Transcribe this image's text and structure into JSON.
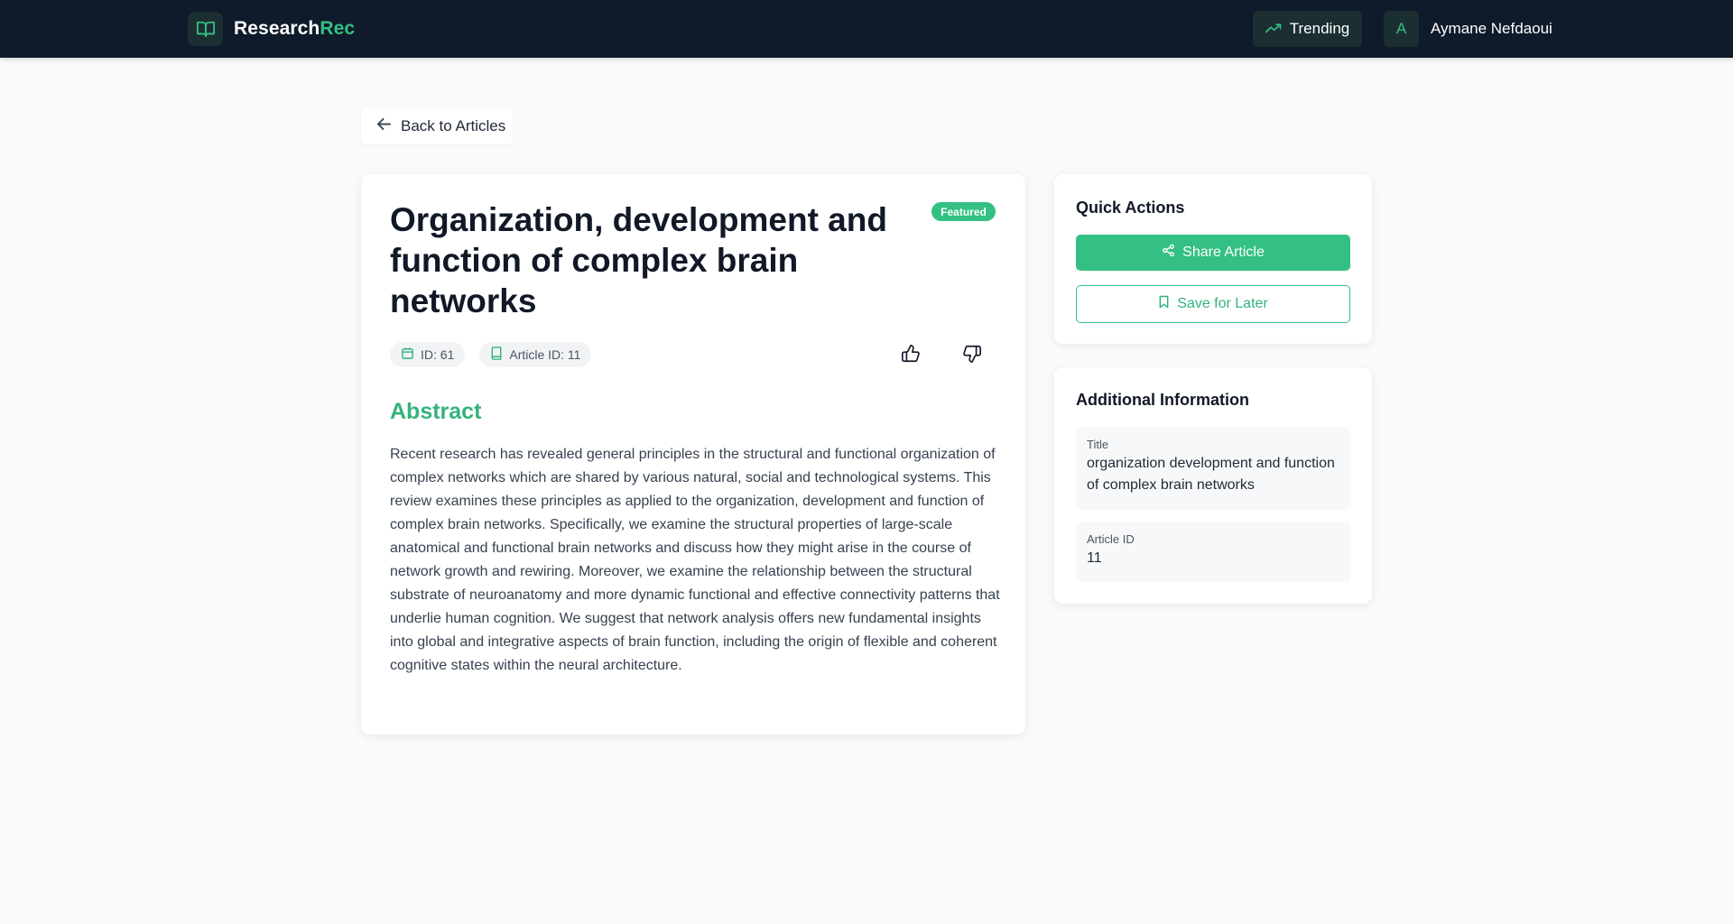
{
  "header": {
    "brand_main": "Research",
    "brand_accent": "Rec",
    "trending_label": "Trending",
    "user_initial": "A",
    "user_name": "Aymane Nefdaoui"
  },
  "nav": {
    "back_label": "Back to Articles"
  },
  "article": {
    "title": "Organization, development and function of complex brain networks",
    "badge": "Featured",
    "chips": [
      "ID: 61",
      "Article ID: 11"
    ],
    "abstract_heading": "Abstract",
    "abstract": "Recent research has revealed general principles in the structural and functional organization of complex networks which are shared by various natural, social and technological systems. This review examines these principles as applied to the organization, development and function of complex brain networks. Specifically, we examine the structural properties of large-scale anatomical and functional brain networks and discuss how they might arise in the course of network growth and rewiring. Moreover, we examine the relationship between the structural substrate of neuroanatomy and more dynamic functional and effective connectivity patterns that underlie human cognition. We suggest that network analysis offers new fundamental insights into global and integrative aspects of brain function, including the origin of flexible and coherent cognitive states within the neural architecture."
  },
  "quick_actions": {
    "heading": "Quick Actions",
    "share_label": "Share Article",
    "save_label": "Save for Later"
  },
  "additional_info": {
    "heading": "Additional Information",
    "title_label": "Title",
    "title_value": "organization development and function of complex brain networks",
    "id_label": "Article ID",
    "id_value": "11"
  },
  "colors": {
    "accent": "#34c084",
    "header_bg": "#0f1b2a"
  }
}
